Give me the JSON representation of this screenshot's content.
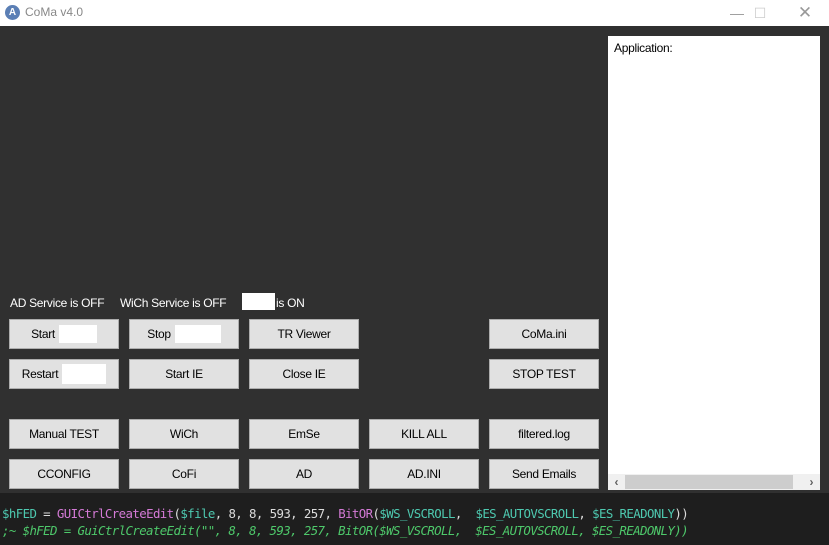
{
  "window": {
    "title": "CoMa  v4.0",
    "icon": "app-logo-icon",
    "controls": [
      "minimize-icon",
      "maximize-icon",
      "close-icon"
    ]
  },
  "status": {
    "ad": "AD Service is OFF",
    "wich": "WiCh Service is OFF",
    "third_suffix": "is ON"
  },
  "buttons": {
    "start": "Start",
    "stop": "Stop",
    "tr_viewer": "TR Viewer",
    "coma_ini": "CoMa.ini",
    "restart": "Restart",
    "start_ie": "Start IE",
    "close_ie": "Close IE",
    "stop_test": "STOP TEST",
    "manual_test": "Manual TEST",
    "wich": "WiCh",
    "emse": "EmSe",
    "kill_all": "KILL ALL",
    "filtered_log": "filtered.log",
    "cconfig": "CCONFIG",
    "cofi": "CoFi",
    "ad": "AD",
    "ad_ini": "AD.INI",
    "send_emails": "Send Emails"
  },
  "panel": {
    "label": "Application:"
  },
  "code": {
    "line1": {
      "var": "$hFED",
      "eq": " = ",
      "fn": "GUICtrlCreateEdit",
      "p1": "(",
      "arg": "$file",
      "nums": ", 8, 8, 593, 257, ",
      "fn2": "BitOR",
      "p2": "(",
      "c1": "$WS_VSCROLL",
      "sep": ",  ",
      "c2": "$ES_AUTOVSCROLL",
      "sep2": ", ",
      "c3": "$ES_READONLY",
      "close": "))"
    },
    "line2": ";~ $hFED = GuiCtrlCreateEdit(\"\", 8, 8, 593, 257, BitOR($WS_VSCROLL,  $ES_AUTOVSCROLL, $ES_READONLY))"
  }
}
